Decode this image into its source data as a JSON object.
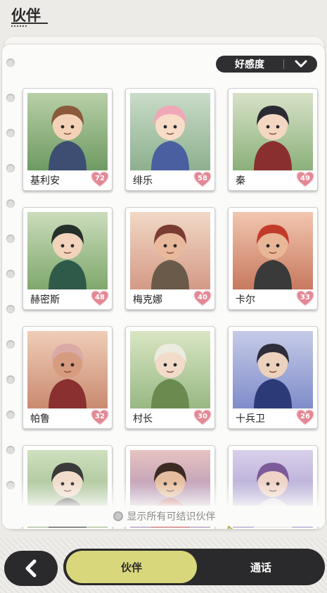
{
  "header": {
    "title": "伙伴"
  },
  "sort": {
    "label": "好感度"
  },
  "companions": [
    {
      "name": "基利安",
      "affinity": "72"
    },
    {
      "name": "绯乐",
      "affinity": "58"
    },
    {
      "name": "秦",
      "affinity": "49"
    },
    {
      "name": "赫密斯",
      "affinity": "48"
    },
    {
      "name": "梅克娜",
      "affinity": "40"
    },
    {
      "name": "卡尔",
      "affinity": "33"
    },
    {
      "name": "帕鲁",
      "affinity": "32"
    },
    {
      "name": "村长",
      "affinity": "30"
    },
    {
      "name": "十兵卫",
      "affinity": "26"
    },
    {
      "name": "",
      "affinity": ""
    },
    {
      "name": "",
      "affinity": ""
    },
    {
      "name": "",
      "affinity": ""
    }
  ],
  "filter": {
    "show_all_label": "显示所有可结识伙伴"
  },
  "bottom_nav": {
    "tab_companions": "伙伴",
    "tab_call": "通话"
  },
  "colors": {
    "accent": "#d8d77c",
    "dark": "#2a2a2c",
    "heart": "#e38895"
  },
  "icons": {
    "back": "chevron-left-icon",
    "sort": "chevron-down-icon",
    "affinity": "heart-icon"
  }
}
